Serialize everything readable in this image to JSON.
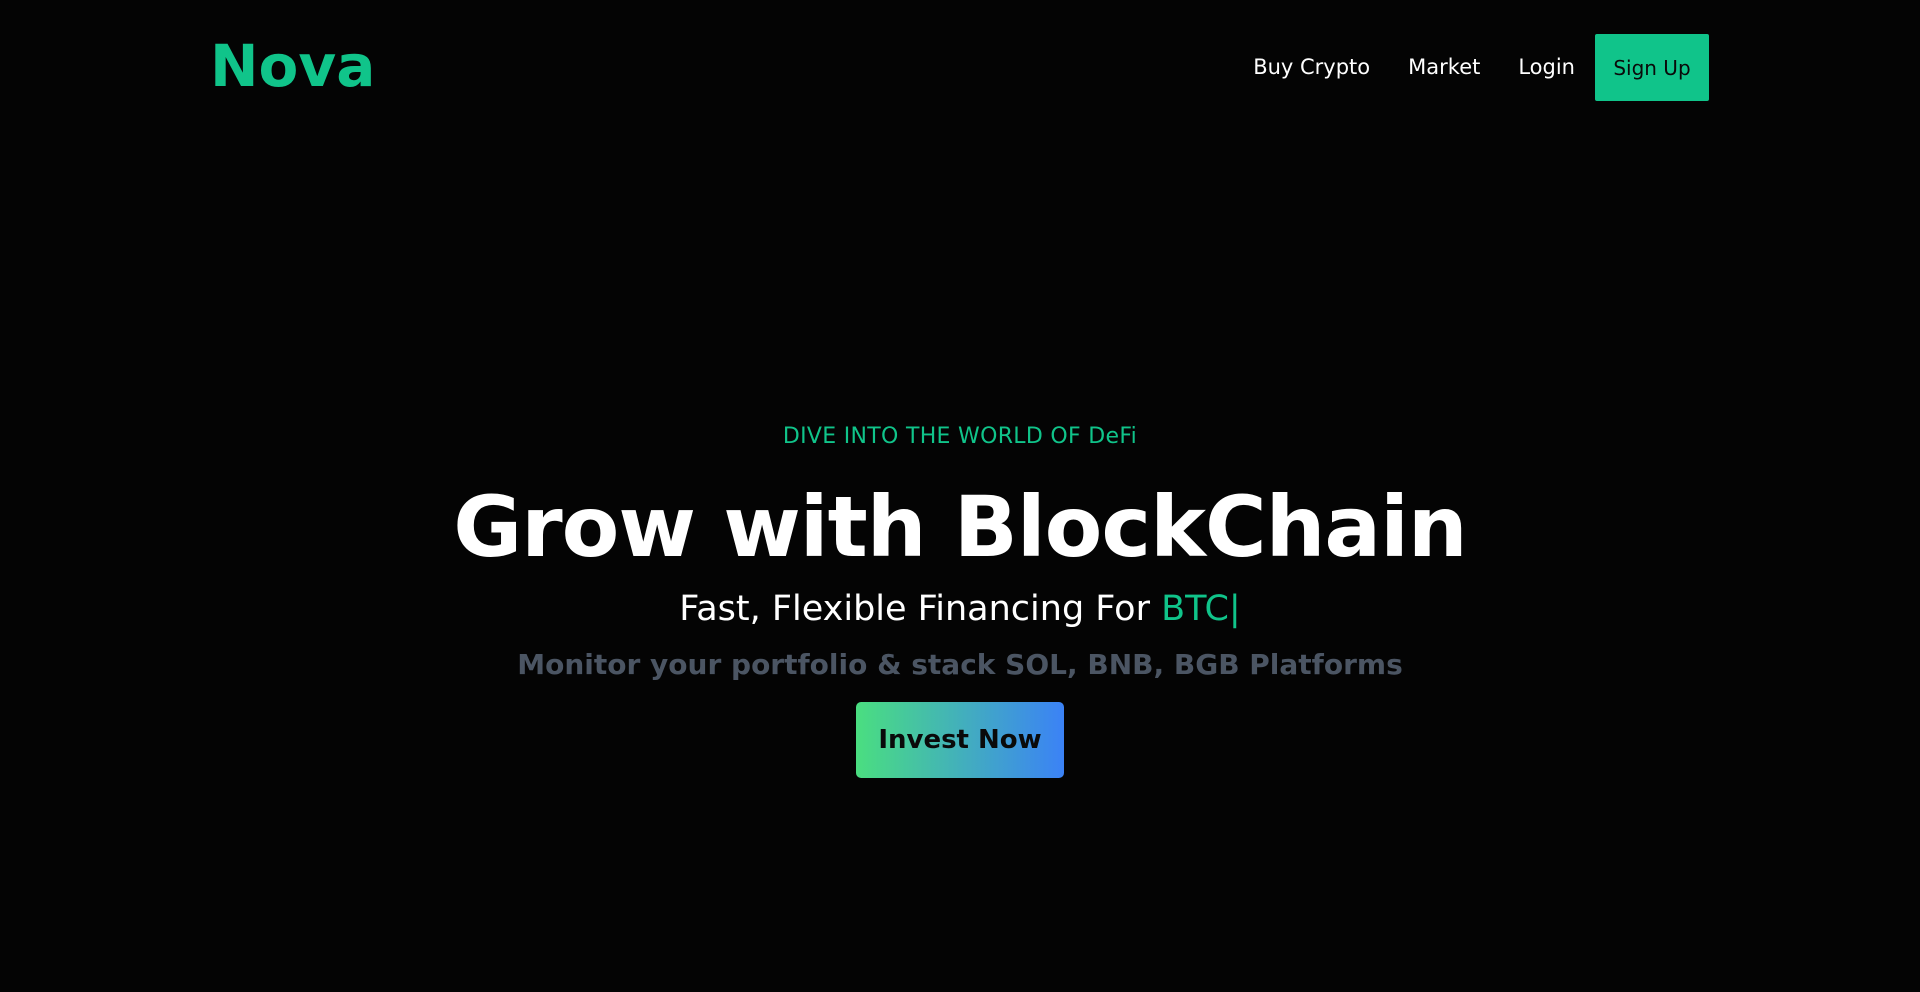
{
  "header": {
    "brand": "Nova",
    "nav": {
      "buy_crypto": "Buy Crypto",
      "market": "Market",
      "login": "Login",
      "signup": "Sign Up"
    }
  },
  "hero": {
    "eyebrow": "DIVE INTO THE WORLD OF DeFi",
    "headline": "Grow with BlockChain",
    "subline_prefix": "Fast, Flexible Financing For ",
    "subline_highlight": "BTC|",
    "caption": "Monitor your portfolio & stack SOL, BNB, BGB Platforms",
    "cta_label": "Invest Now"
  },
  "colors": {
    "background": "#040404",
    "accent": "#10c48a",
    "caption_gray": "#4b5563",
    "cta_gradient_start": "#4ade80",
    "cta_gradient_end": "#3b82f6"
  }
}
